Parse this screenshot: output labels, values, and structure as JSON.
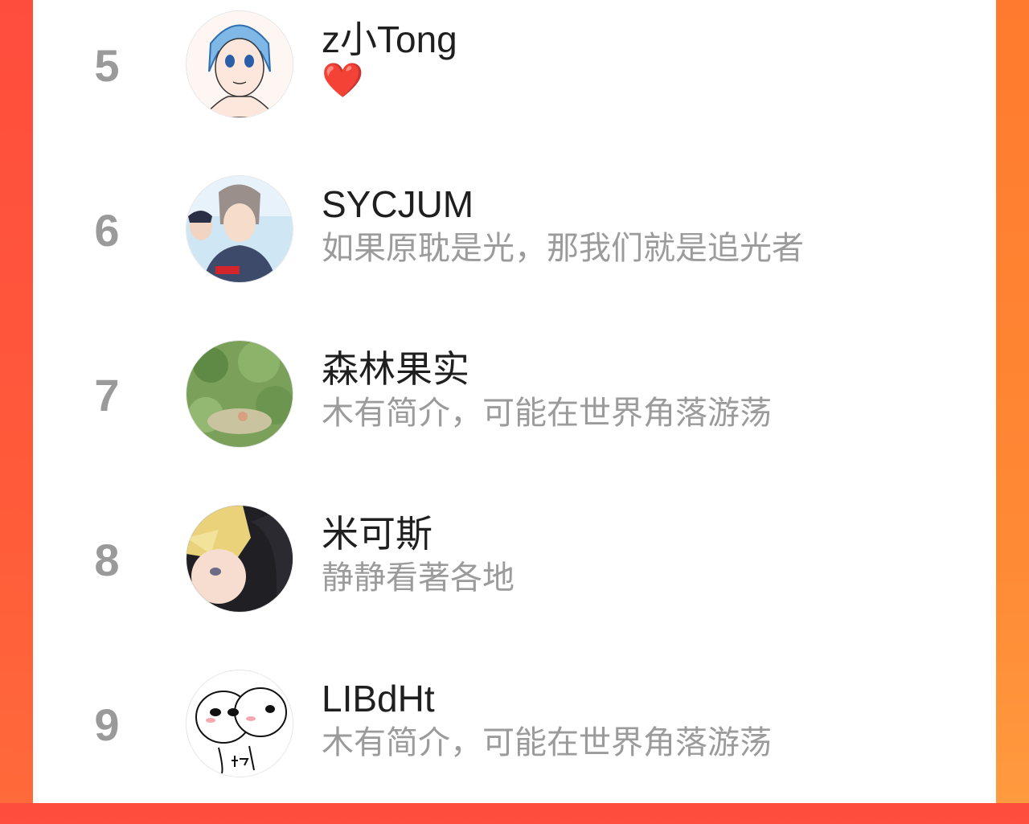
{
  "ranking": {
    "items": [
      {
        "rank": "5",
        "name": "z小Tong",
        "bio": "❤️",
        "avatar_icon": "anime-girl-blue-hair-avatar"
      },
      {
        "rank": "6",
        "name": "SYCJUM",
        "bio": "如果原耽是光，那我们就是追光者",
        "avatar_icon": "anime-boys-hoodie-avatar"
      },
      {
        "rank": "7",
        "name": "森林果实",
        "bio": "木有简介，可能在世界角落游荡",
        "avatar_icon": "forest-scene-avatar"
      },
      {
        "rank": "8",
        "name": "米可斯",
        "bio": "静静看著各地",
        "avatar_icon": "blonde-anime-boy-avatar"
      },
      {
        "rank": "9",
        "name": "LIBdHt",
        "bio": "木有简介，可能在世界角落游荡",
        "avatar_icon": "cartoon-faces-avatar"
      }
    ]
  },
  "colors": {
    "accent_left": "#ff4d3d",
    "accent_right": "#ff8a35",
    "rank_text": "#9a9a9a",
    "bio_text": "#9b9b9b",
    "name_text": "#1f1f1f"
  }
}
